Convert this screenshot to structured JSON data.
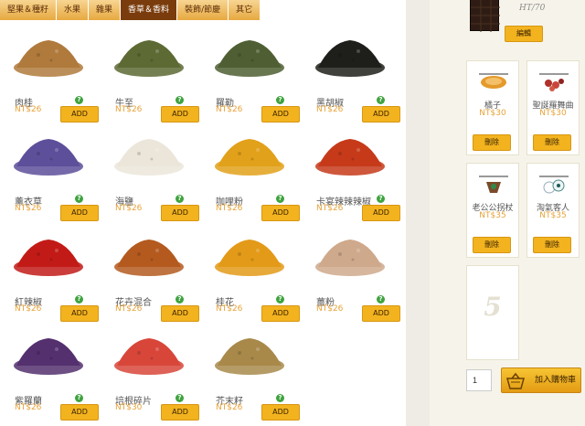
{
  "tabs": [
    {
      "label": "堅果＆種籽"
    },
    {
      "label": "水果"
    },
    {
      "label": "雜果"
    },
    {
      "label": "香草＆香料",
      "active": true
    },
    {
      "label": "裝飾/節慶"
    },
    {
      "label": "其它"
    }
  ],
  "products": [
    {
      "name": "肉桂",
      "price": "NT$26",
      "icon": "cinnamon-powder",
      "color": "#b07a3c"
    },
    {
      "name": "牛至",
      "price": "NT$26",
      "icon": "oregano-leaves",
      "color": "#5d6a34"
    },
    {
      "name": "羅勒",
      "price": "NT$26",
      "icon": "basil-leaves",
      "color": "#4f5f33"
    },
    {
      "name": "黑胡椒",
      "price": "NT$26",
      "icon": "black-pepper",
      "color": "#1e1e1a"
    },
    {
      "name": "薰衣草",
      "price": "NT$26",
      "icon": "lavender",
      "color": "#5e4f9a"
    },
    {
      "name": "海鹽",
      "price": "NT$26",
      "icon": "sea-salt",
      "color": "#ece6da"
    },
    {
      "name": "咖哩粉",
      "price": "NT$26",
      "icon": "curry-powder",
      "color": "#e2a11a"
    },
    {
      "name": "卡宴辣辣辣椒",
      "price": "NT$26",
      "icon": "cayenne-pepper",
      "color": "#c63a1a"
    },
    {
      "name": "紅辣椒",
      "price": "NT$26",
      "icon": "red-chili-powder",
      "color": "#c21b17"
    },
    {
      "name": "花卉混合",
      "price": "NT$26",
      "icon": "flower-mix",
      "color": "#b45a1f"
    },
    {
      "name": "桂花",
      "price": "NT$26",
      "icon": "osmanthus",
      "color": "#e39a18"
    },
    {
      "name": "薑粉",
      "price": "NT$26",
      "icon": "ginger-powder",
      "color": "#cfa98c"
    },
    {
      "name": "紫羅蘭",
      "price": "NT$26",
      "icon": "violet-flowers",
      "color": "#54306f"
    },
    {
      "name": "培根碎片",
      "price": "NT$30",
      "icon": "bacon-bits",
      "color": "#d8463a"
    },
    {
      "name": "芥末籽",
      "price": "NT$26",
      "icon": "mustard-seeds",
      "color": "#a8894a"
    }
  ],
  "add_label": "ADD",
  "help_glyph": "?",
  "sidebar": {
    "top_item": {
      "logo_text": "HT/70",
      "edit_label": "編輯"
    },
    "items": [
      {
        "name": "橘子",
        "price": "NT$30",
        "remove_label": "刪除",
        "icon": "orange-slice-icon"
      },
      {
        "name": "聖誕羅舞曲",
        "price": "NT$30",
        "remove_label": "刪除",
        "icon": "berry-mix-icon"
      },
      {
        "name": "老公公拐杖",
        "price": "NT$35",
        "remove_label": "刪除",
        "icon": "ornament-icon"
      },
      {
        "name": "淘氣客人",
        "price": "NT$35",
        "remove_label": "刪除",
        "icon": "snowman-icon"
      }
    ],
    "empty_slot_number": "5",
    "quantity": "1",
    "add_to_cart_label": "加入購物車"
  }
}
